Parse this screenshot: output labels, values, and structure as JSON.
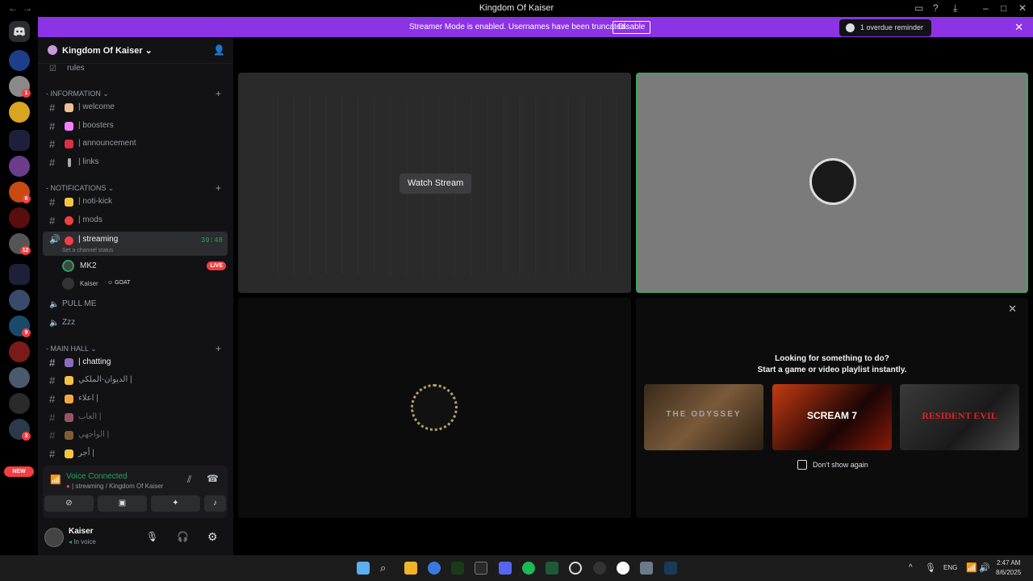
{
  "window": {
    "title": "Kingdom Of Kaiser",
    "nav_back": "←",
    "nav_forward": "→"
  },
  "banner": {
    "message": "Streamer Mode is enabled. Usernames have been truncated.",
    "disable_label": "Disable",
    "reminder": "1 overdue reminder"
  },
  "server": {
    "name": "Kingdom Of Kaiser"
  },
  "rail": {
    "badges": [
      "1",
      "6",
      "12",
      "9",
      "3"
    ],
    "new_label": "NEW"
  },
  "channels": {
    "top": [
      {
        "label": "rules"
      }
    ],
    "information": {
      "title": "INFORMATION",
      "items": [
        {
          "label": "| welcome",
          "color": "#f0c090"
        },
        {
          "label": "| boosters",
          "color": "#f47fff"
        },
        {
          "label": "| announcement",
          "color": "#dd2e44"
        },
        {
          "label": "| links",
          "color": "#aaaaaa"
        }
      ]
    },
    "notifications": {
      "title": "NOTIFICATIONS",
      "items": [
        {
          "label": "| noti-kick",
          "color": "#f4c542"
        },
        {
          "label": "| mods",
          "color": "#f23f43"
        }
      ]
    },
    "streaming": {
      "label": "| streaming",
      "status": "Set a channel status",
      "timer": "39:48",
      "users": [
        {
          "name": "ΜΚ2",
          "live": "LIVE"
        },
        {
          "name": "Kaiser",
          "tag": "GOAT"
        }
      ]
    },
    "voice": [
      {
        "label": "PULL ME"
      },
      {
        "label": "Zzz"
      }
    ],
    "main_hall": {
      "title": "MAIN HALL",
      "items": [
        {
          "label": "| chatting",
          "color": "#8e6bbf"
        },
        {
          "label": "الديوان-الملكي |",
          "color": "#f4c542"
        },
        {
          "label": "اعلاء |",
          "color": "#f4a742"
        },
        {
          "label": "العاب |",
          "color": "#f47fa0"
        },
        {
          "label": "الواجهي |",
          "color": "#c88f4a"
        },
        {
          "label": "أجر |",
          "color": "#f4c542"
        }
      ]
    }
  },
  "voice_panel": {
    "status": "Voice Connected",
    "sub": "| streaming / Kingdom Of Kaiser"
  },
  "user": {
    "name": "Kaiser",
    "status": "In voice"
  },
  "stream": {
    "watch_label": "Watch Stream"
  },
  "activity": {
    "line1": "Looking for something to do?",
    "line2": "Start a game or video playlist instantly.",
    "games": [
      {
        "title": "THE ODYSSEY"
      },
      {
        "title": "SCREAM 7"
      },
      {
        "title": "RESIDENT EVIL"
      }
    ],
    "dont_show": "Don't show again"
  },
  "taskbar": {
    "lang": "ENG",
    "time": "2:47 AM",
    "date": "8/6/2025"
  },
  "colors": {
    "banner": "#8c33e6",
    "online": "#23a55a",
    "live": "#f23f43",
    "selected_border": "#3ba55c"
  }
}
